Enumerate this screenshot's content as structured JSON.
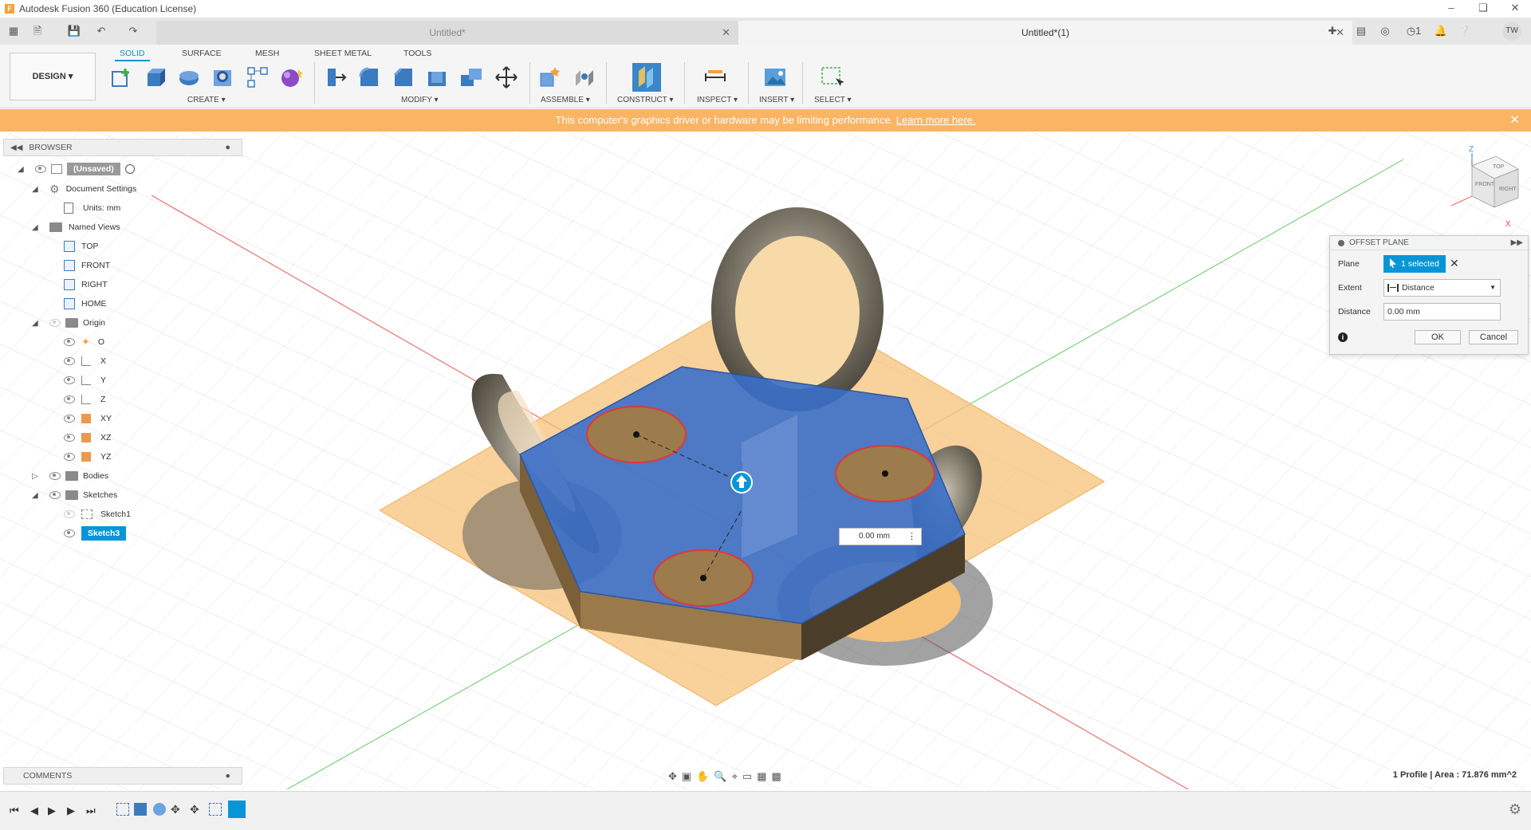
{
  "window": {
    "title": "Autodesk Fusion 360 (Education License)",
    "app_icon": "F"
  },
  "tabs": [
    {
      "label": "Untitled*"
    },
    {
      "label": "Untitled*(1)"
    }
  ],
  "user": {
    "initials": "TW",
    "jobs_count": "1"
  },
  "ribbon": {
    "workspace": "DESIGN ▾",
    "tabs": [
      "SOLID",
      "SURFACE",
      "MESH",
      "SHEET METAL",
      "TOOLS"
    ],
    "active_tab": "SOLID",
    "groups": [
      "CREATE ▾",
      "MODIFY ▾",
      "ASSEMBLE ▾",
      "CONSTRUCT ▾",
      "INSPECT ▾",
      "INSERT ▾",
      "SELECT ▾"
    ]
  },
  "warning": {
    "text": "This computer's graphics driver or hardware may be limiting performance.",
    "link": "Learn more here."
  },
  "browser": {
    "title": "BROWSER",
    "root": "(Unsaved)",
    "document_settings": "Document Settings",
    "units": "Units: mm",
    "named_views": "Named Views",
    "views": [
      "TOP",
      "FRONT",
      "RIGHT",
      "HOME"
    ],
    "origin": "Origin",
    "origin_items": [
      "O",
      "X",
      "Y",
      "Z",
      "XY",
      "XZ",
      "YZ"
    ],
    "bodies": "Bodies",
    "sketches": "Sketches",
    "sketch_items": [
      "Sketch1",
      "Sketch3"
    ]
  },
  "dialog": {
    "title": "OFFSET PLANE",
    "plane_label": "Plane",
    "plane_value": "1 selected",
    "extent_label": "Extent",
    "extent_value": "Distance",
    "distance_label": "Distance",
    "distance_value": "0.00 mm",
    "ok": "OK",
    "cancel": "Cancel"
  },
  "canvas_input": "0.00 mm",
  "navcube": {
    "top": "TOP",
    "front": "FRONT",
    "right": "RIGHT",
    "z": "Z",
    "x": "X"
  },
  "comments": {
    "title": "COMMENTS"
  },
  "status": "1 Profile | Area : 71.876 mm^2",
  "colors": {
    "accent": "#0696d7",
    "warning": "#fbb463",
    "plane": "#f7c27a",
    "selection_blue": "#3b6fc9",
    "body": "#9a7a4a"
  }
}
